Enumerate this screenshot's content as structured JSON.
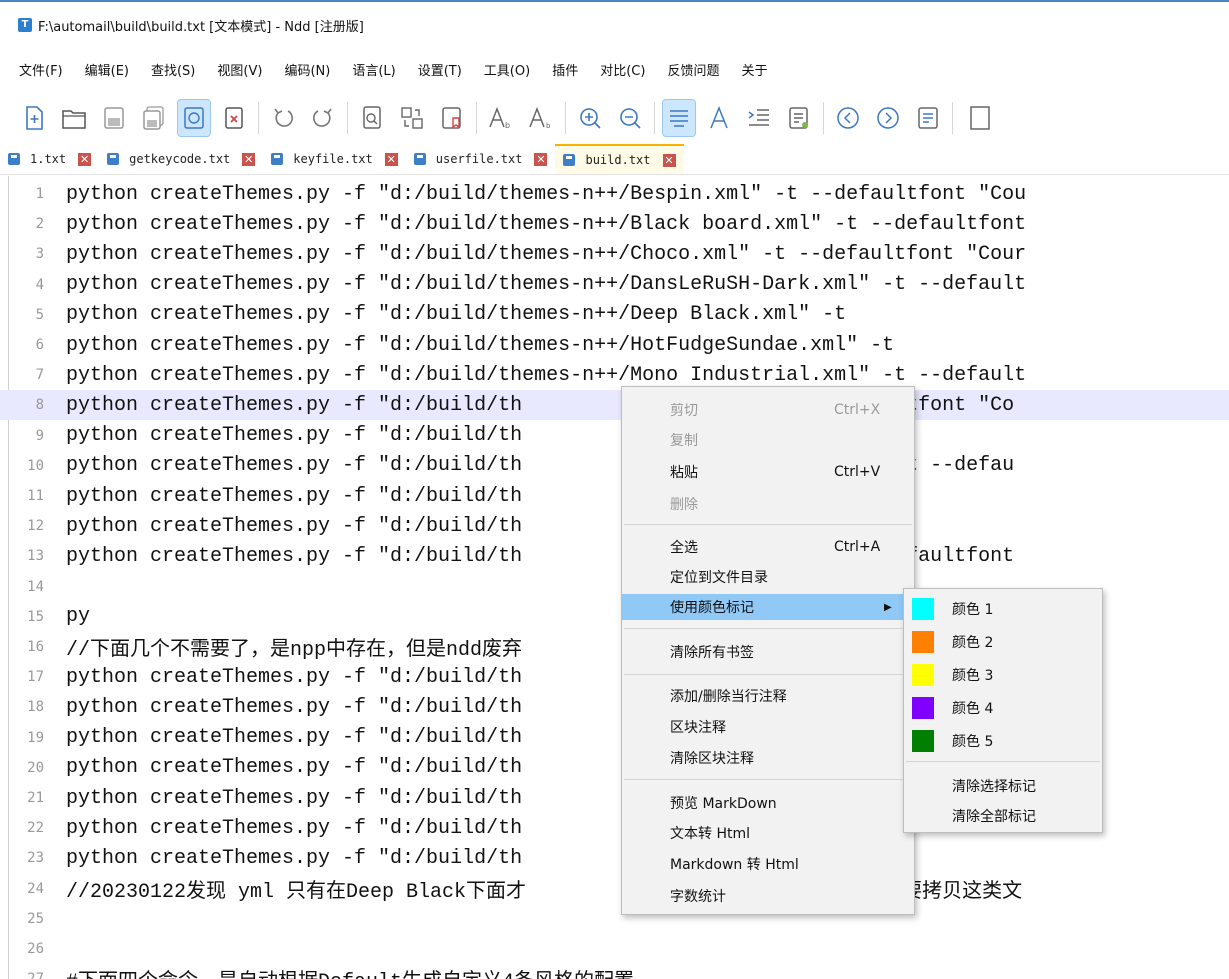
{
  "window": {
    "title": "F:\\automail\\build\\build.txt [文本模式] - Ndd [注册版]",
    "icon": "T"
  },
  "menu": [
    "文件(F)",
    "编辑(E)",
    "查找(S)",
    "视图(V)",
    "编码(N)",
    "语言(L)",
    "设置(T)",
    "工具(O)",
    "插件",
    "对比(C)",
    "反馈问题",
    "关于"
  ],
  "tabs": [
    {
      "label": "1.txt"
    },
    {
      "label": "getkeycode.txt"
    },
    {
      "label": "keyfile.txt"
    },
    {
      "label": "userfile.txt"
    },
    {
      "label": "build.txt"
    }
  ],
  "lines": [
    {
      "n": "1",
      "text": "python createThemes.py -f \"d:/build/themes-n++/Bespin.xml\" -t --defaultfont \"Cou"
    },
    {
      "n": "2",
      "text": "python createThemes.py -f \"d:/build/themes-n++/Black board.xml\" -t --defaultfont"
    },
    {
      "n": "3",
      "text": "python createThemes.py -f \"d:/build/themes-n++/Choco.xml\" -t --defaultfont \"Cour"
    },
    {
      "n": "4",
      "text": "python createThemes.py -f \"d:/build/themes-n++/DansLeRuSH-Dark.xml\" -t --default"
    },
    {
      "n": "5",
      "text": "python createThemes.py -f \"d:/build/themes-n++/Deep Black.xml\" -t"
    },
    {
      "n": "6",
      "text": "python createThemes.py -f \"d:/build/themes-n++/HotFudgeSundae.xml\" -t"
    },
    {
      "n": "7",
      "text": "python createThemes.py -f \"d:/build/themes-n++/Mono Industrial.xml\" -t --default"
    },
    {
      "n": "8",
      "text": "python createThemes.py -f \"d:/build/th                   \" -t --defaultfont \"Co"
    },
    {
      "n": "9",
      "text": "python createThemes.py -f \"d:/build/th                   l\" -t"
    },
    {
      "n": "10",
      "text": "python createThemes.py -f \"d:/build/th                   e Wrap.xml\" -t --defau"
    },
    {
      "n": "11",
      "text": "python createThemes.py -f \"d:/build/th                   ml\" -t"
    },
    {
      "n": "12",
      "text": "python createThemes.py -f \"d:/build/th                   l\" -t"
    },
    {
      "n": "13",
      "text": "python createThemes.py -f \"d:/build/th                   .xml\" -t --defaultfont"
    },
    {
      "n": "14",
      "text": ""
    },
    {
      "n": "15",
      "text": "py"
    },
    {
      "n": "16",
      "text": "//下面几个不需要了，是npp中存在，但是ndd废弃"
    },
    {
      "n": "17",
      "text": "python createThemes.py -f \"d:/build/th"
    },
    {
      "n": "18",
      "text": "python createThemes.py -f \"d:/build/th"
    },
    {
      "n": "19",
      "text": "python createThemes.py -f \"d:/build/th"
    },
    {
      "n": "20",
      "text": "python createThemes.py -f \"d:/build/th"
    },
    {
      "n": "21",
      "text": "python createThemes.py -f \"d:/build/th"
    },
    {
      "n": "22",
      "text": "python createThemes.py -f \"d:/build/th"
    },
    {
      "n": "23",
      "text": "python createThemes.py -f \"d:/build/th                   \" -t"
    },
    {
      "n": "24",
      "text": "//20230122发现 yml 只有在Deep Black下面才                  主题没有。所以需要拷贝这类文"
    },
    {
      "n": "25",
      "text": ""
    },
    {
      "n": "26",
      "text": ""
    },
    {
      "n": "27",
      "text": "#下面四个命令，是自动根据Default生成自定义4条风格的配置"
    }
  ],
  "highlight_line": "8",
  "context_menu": {
    "cut": "剪切",
    "cut_sc": "Ctrl+X",
    "copy": "复制",
    "paste": "粘贴",
    "paste_sc": "Ctrl+V",
    "delete": "删除",
    "select_all": "全选",
    "select_all_sc": "Ctrl+A",
    "locate_dir": "定位到文件目录",
    "color_mark": "使用颜色标记",
    "clear_bookmarks": "清除所有书签",
    "toggle_comment": "添加/删除当行注释",
    "block_comment": "区块注释",
    "clear_block_comment": "清除区块注释",
    "preview_md": "预览 MarkDown",
    "text_to_html": "文本转 Html",
    "md_to_html": "Markdown 转 Html",
    "word_count": "字数统计"
  },
  "color_submenu": {
    "items": [
      {
        "label": "颜色 1",
        "color": "#00ffff"
      },
      {
        "label": "颜色 2",
        "color": "#ff7f00"
      },
      {
        "label": "颜色 3",
        "color": "#ffff00"
      },
      {
        "label": "颜色 4",
        "color": "#8000ff"
      },
      {
        "label": "颜色 5",
        "color": "#007f00"
      }
    ],
    "clear_selected": "清除选择标记",
    "clear_all": "清除全部标记"
  }
}
